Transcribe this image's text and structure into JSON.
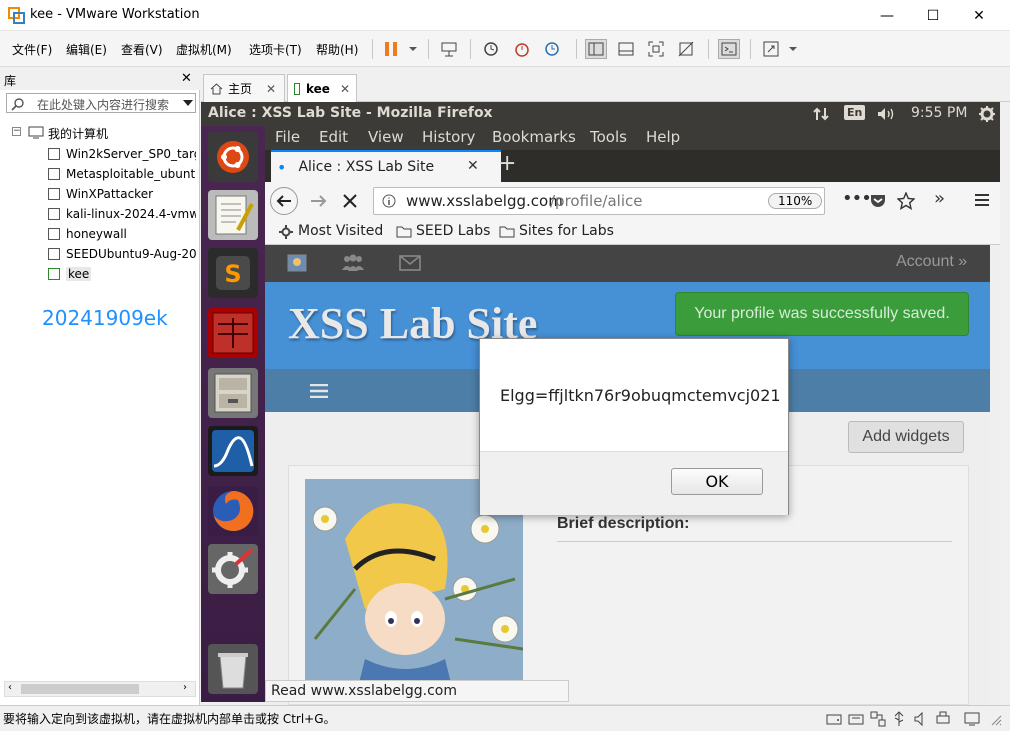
{
  "window": {
    "title": "kee - VMware Workstation",
    "minimize": "—",
    "maximize": "☐",
    "close": "✕"
  },
  "menu": [
    "文件(F)",
    "编辑(E)",
    "查看(V)",
    "虚拟机(M)",
    "选项卡(T)",
    "帮助(H)"
  ],
  "library": {
    "title": "库",
    "close": "✕",
    "search_placeholder": "在此处键入内容进行搜索",
    "root": "我的计算机",
    "items": [
      "Win2kServer_SP0_target",
      "Metasploitable_ubuntu",
      "WinXPattacker",
      "kali-linux-2024.4-vmware",
      "honeywall",
      "SEEDUbuntu9-Aug-2010",
      "kee"
    ],
    "watermark": "20241909ek"
  },
  "tabs": {
    "home": "主页",
    "vm": "kee",
    "close": "✕"
  },
  "ubuntu": {
    "window_title": "Alice : XSS Lab Site - Mozilla Firefox",
    "lang": "En",
    "time": "9:55 PM"
  },
  "firefox": {
    "menu": [
      "File",
      "Edit",
      "View",
      "History",
      "Bookmarks",
      "Tools",
      "Help"
    ],
    "tab_title": "Alice : XSS Lab Site",
    "tab_close": "✕",
    "new_tab": "+",
    "url_host": "www.xsslabelgg.com",
    "url_path": "/profile/alice",
    "zoom": "110%",
    "bookmarks": [
      "Most Visited",
      "SEED Labs",
      "Sites for Labs"
    ],
    "status": "Read www.xsslabelgg.com"
  },
  "page": {
    "account": "Account »",
    "site_title": "XSS Lab Site",
    "success_msg": "Your profile was successfully saved.",
    "add_widgets": "Add widgets",
    "brief_description": "Brief description:"
  },
  "dialog": {
    "message": "Elgg=ffjltkn76r9obuqmctemvcj021",
    "ok": "OK"
  },
  "statusbar": {
    "text": "要将输入定向到该虚拟机，请在虚拟机内部单击或按 Ctrl+G。"
  }
}
